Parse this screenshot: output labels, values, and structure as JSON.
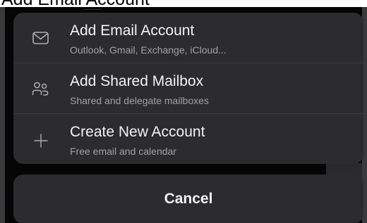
{
  "background_title": "Add Email Account",
  "sheet": {
    "items": [
      {
        "title": "Add Email Account",
        "subtitle": "Outlook, Gmail, Exchange, iCloud...",
        "icon": "envelope-icon"
      },
      {
        "title": "Add Shared Mailbox",
        "subtitle": "Shared and delegate mailboxes",
        "icon": "people-icon"
      },
      {
        "title": "Create New Account",
        "subtitle": "Free email and calendar",
        "icon": "plus-icon"
      }
    ]
  },
  "cancel_label": "Cancel",
  "colors": {
    "sheet_background": "#2c2c2e",
    "primary_text": "#f2f2f7",
    "secondary_text": "#a1a1a6",
    "icon": "#aeaeb2"
  }
}
